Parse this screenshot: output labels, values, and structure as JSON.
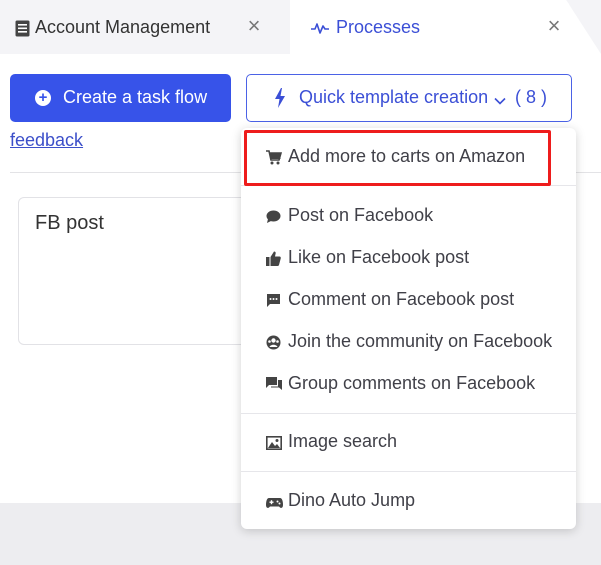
{
  "tabs": [
    {
      "label": "Account Management",
      "icon": "document-icon"
    },
    {
      "label": "Processes",
      "icon": "pulse-icon"
    }
  ],
  "toolbar": {
    "create_label": "Create a task flow",
    "quick_label": "Quick template creation",
    "quick_count": "( 8 )",
    "feedback_label": "feedback"
  },
  "card": {
    "title": "FB post"
  },
  "dropdown": {
    "items": [
      {
        "label": "Add more to carts on Amazon",
        "icon": "cart-icon"
      },
      {
        "label": "Post on Facebook",
        "icon": "chat-bubble-icon"
      },
      {
        "label": "Like on Facebook post",
        "icon": "thumbs-up-icon"
      },
      {
        "label": "Comment on Facebook post",
        "icon": "comment-icon"
      },
      {
        "label": "Join the community on Facebook",
        "icon": "community-icon"
      },
      {
        "label": "Group comments on Facebook",
        "icon": "comments-icon"
      },
      {
        "label": "Image search",
        "icon": "image-icon"
      },
      {
        "label": "Dino Auto Jump",
        "icon": "gamepad-icon"
      }
    ]
  },
  "colors": {
    "primary": "#3753e9",
    "highlight": "#ee1c1c",
    "link": "#3c4fc9"
  }
}
